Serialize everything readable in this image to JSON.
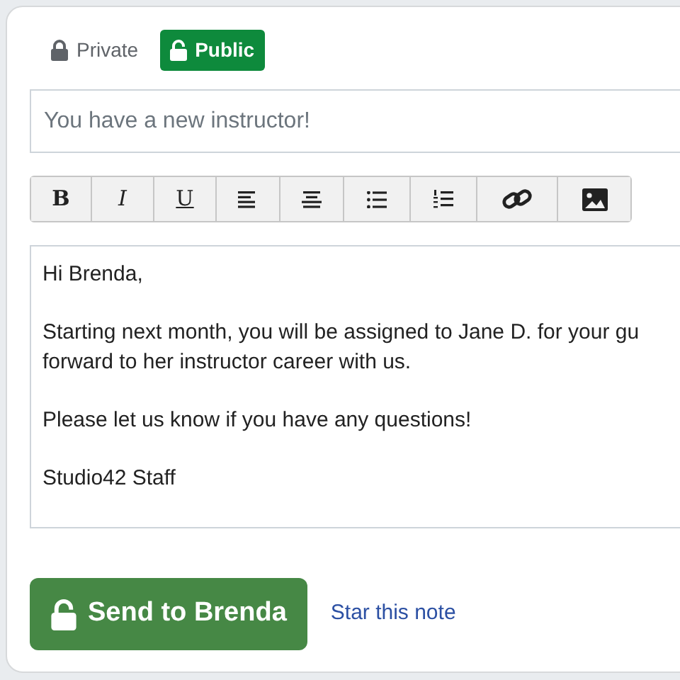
{
  "visibility": [
    {
      "label": "Private",
      "selected": false
    },
    {
      "label": "Public",
      "selected": true
    }
  ],
  "subject": {
    "value": "You have a new instructor!"
  },
  "toolbar": [
    {
      "kind": "bold",
      "label": "B"
    },
    {
      "kind": "italic",
      "label": "I"
    },
    {
      "kind": "underline",
      "label": "U"
    },
    {
      "kind": "align-left"
    },
    {
      "kind": "align-center"
    },
    {
      "kind": "bullet-list"
    },
    {
      "kind": "numbered-list"
    },
    {
      "kind": "link"
    },
    {
      "kind": "image"
    }
  ],
  "body": {
    "paragraphs": [
      [
        "Hi Brenda,"
      ],
      [
        "Starting next month, you will be assigned to Jane D. for your gu",
        "forward to her instructor career with us."
      ],
      [
        "Please let us know if you have any questions!"
      ],
      [
        "Studio42 Staff"
      ]
    ]
  },
  "send_button": {
    "label": "Send to Brenda"
  },
  "star_link": {
    "label": "Star this note"
  }
}
